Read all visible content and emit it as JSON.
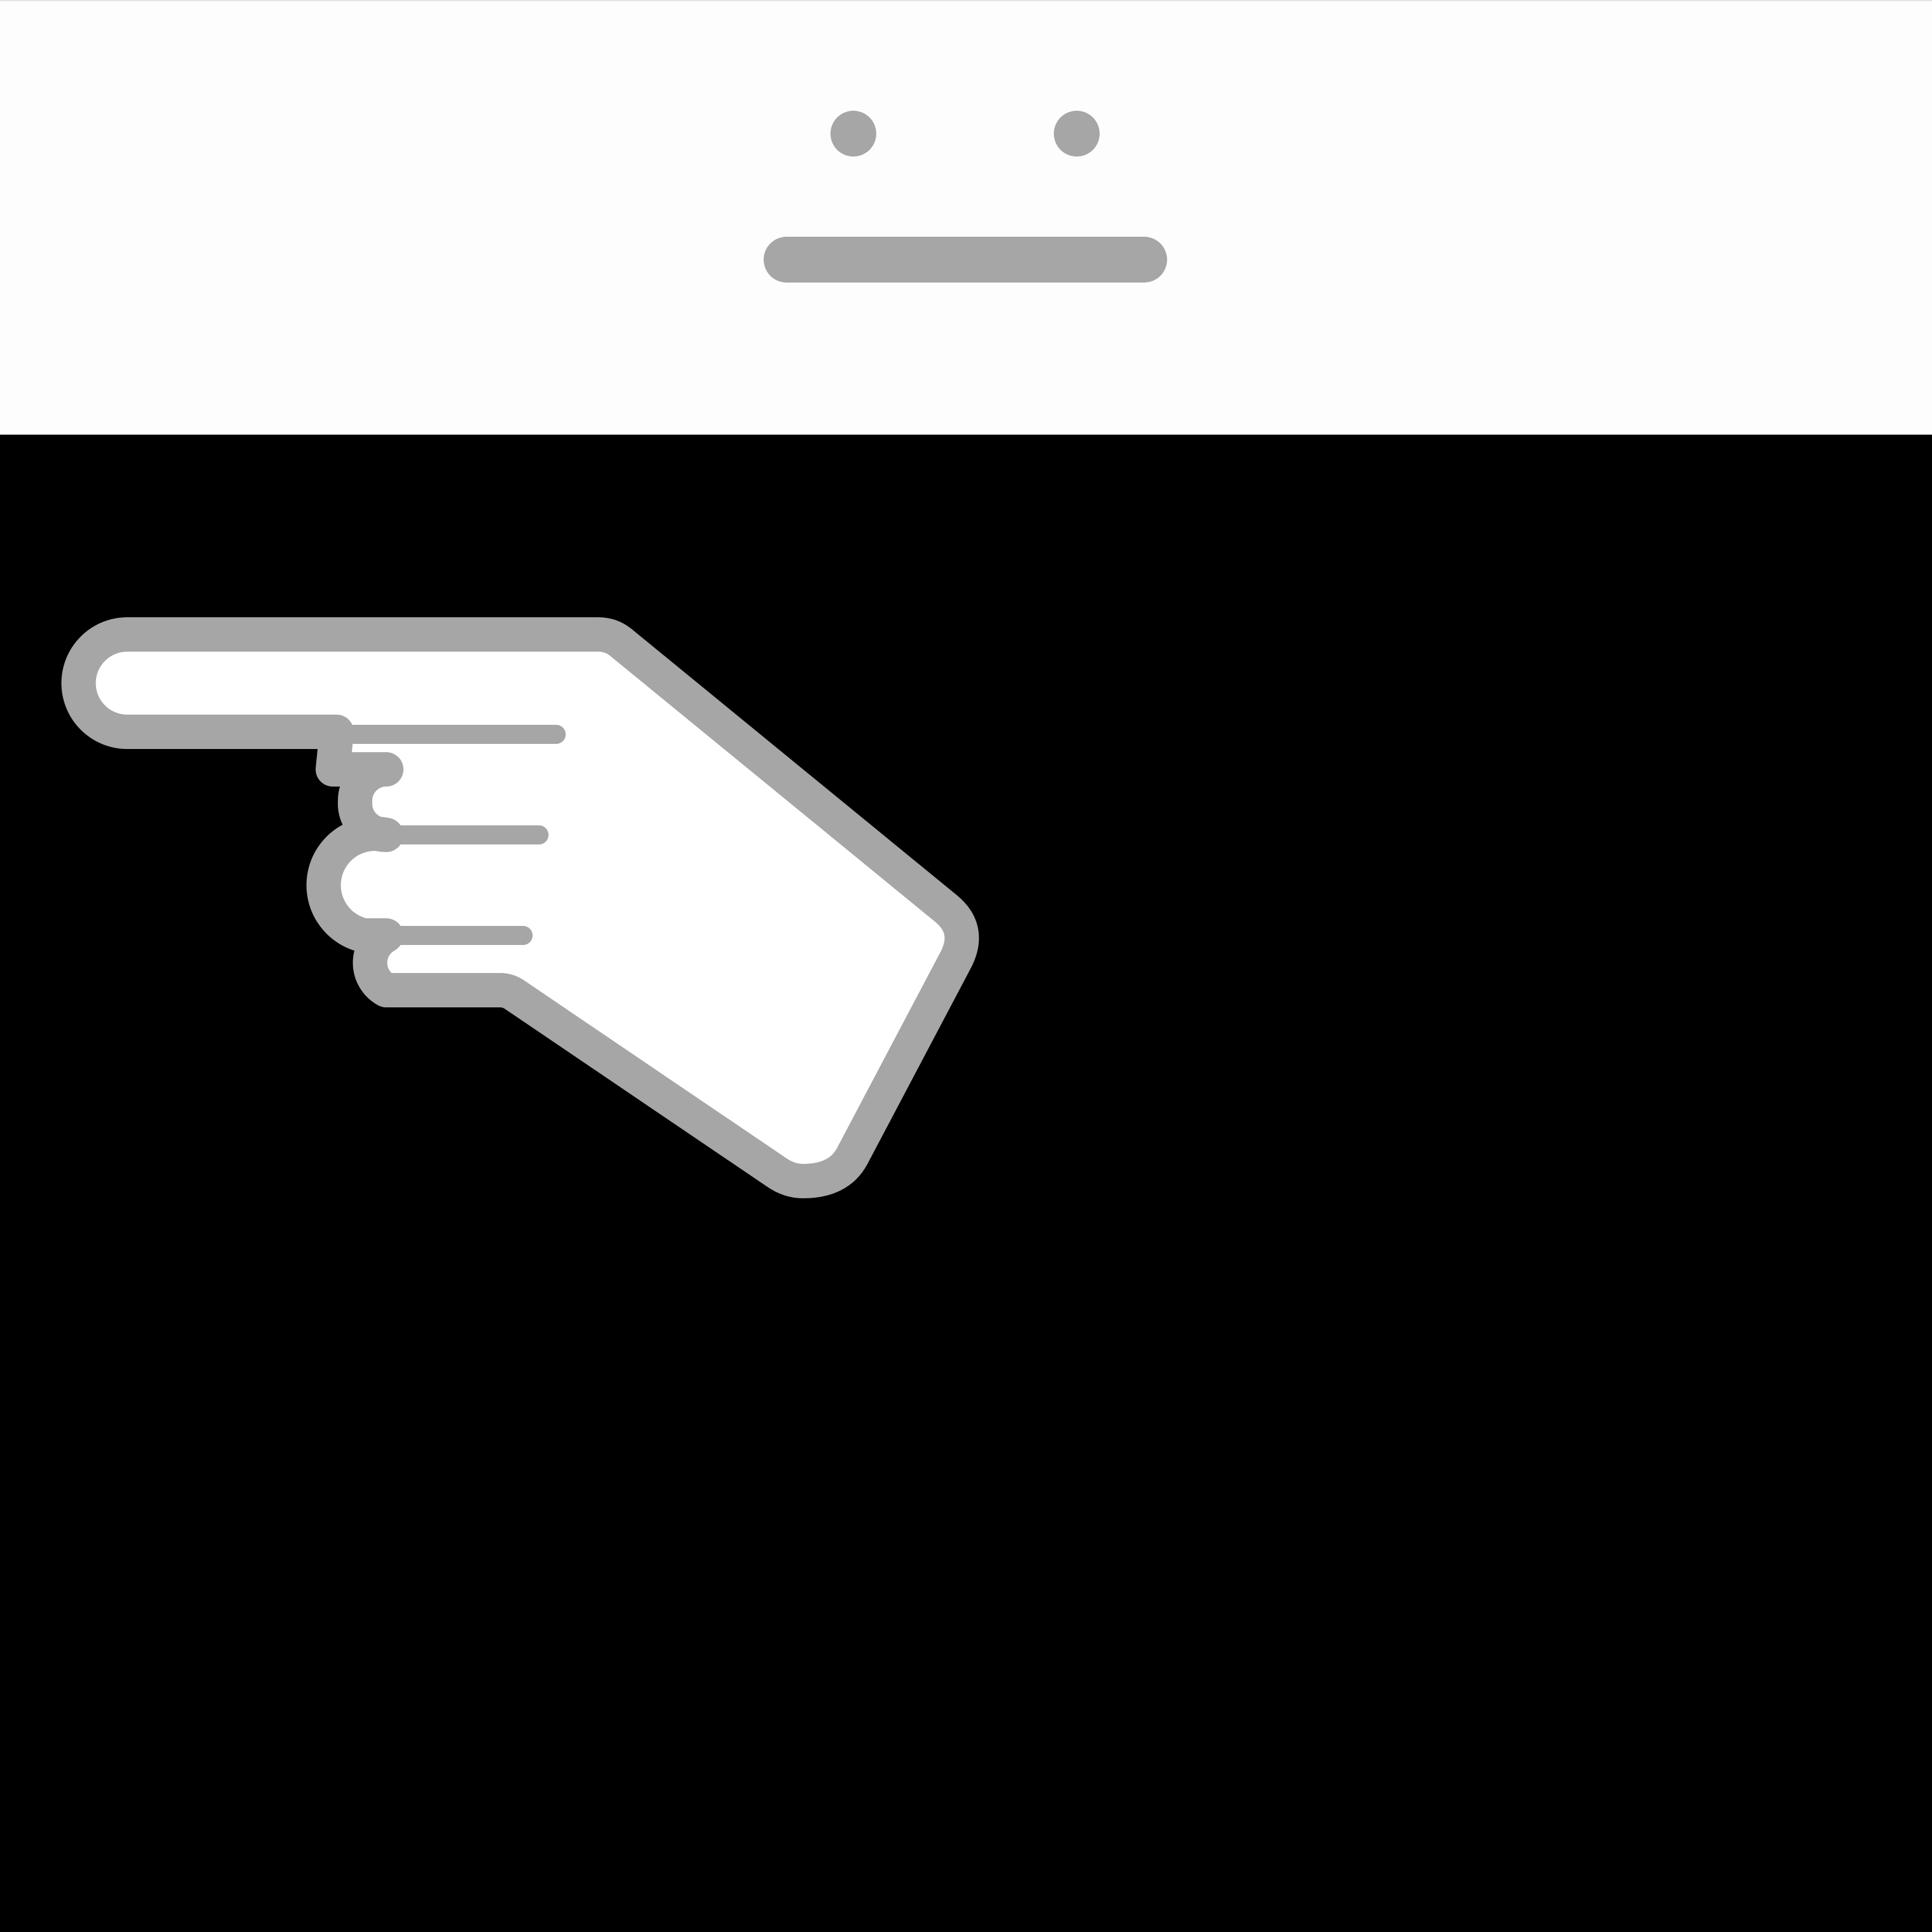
{
  "colors": {
    "top_background": "#fdfdfd",
    "bottom_background": "#000000",
    "glyph_gray": "#a6a6a6",
    "hand_fill": "#ffffff",
    "hand_outline": "#a6a6a6"
  },
  "icons": {
    "face": "neutral-face-icon",
    "hand": "pointing-left-hand-icon"
  }
}
